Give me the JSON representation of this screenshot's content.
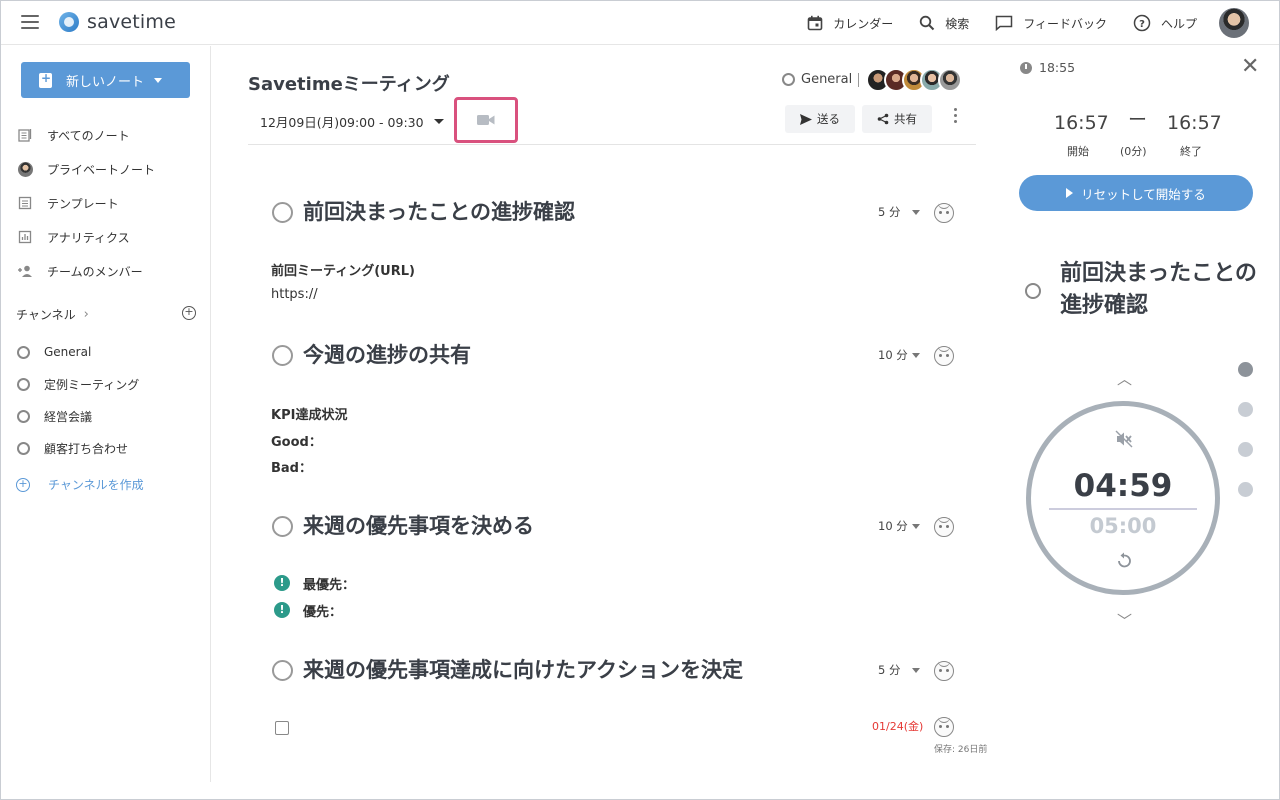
{
  "app": {
    "name": "savetime"
  },
  "topnav": [
    {
      "label": "カレンダー",
      "icon": "calendar-icon"
    },
    {
      "label": "検索",
      "icon": "search-icon"
    },
    {
      "label": "フィードバック",
      "icon": "feedback-icon"
    },
    {
      "label": "ヘルプ",
      "icon": "help-icon"
    }
  ],
  "sidebar": {
    "new_note": "新しいノート",
    "items": [
      {
        "label": "すべてのノート",
        "icon": "notes-icon"
      },
      {
        "label": "プライベートノート",
        "icon": "avatar-icon"
      },
      {
        "label": "テンプレート",
        "icon": "template-icon"
      },
      {
        "label": "アナリティクス",
        "icon": "analytics-icon"
      },
      {
        "label": "チームのメンバー",
        "icon": "add-member-icon"
      }
    ],
    "channels_label": "チャンネル",
    "channels": [
      "General",
      "定例ミーティング",
      "経営会議",
      "顧客打ち合わせ"
    ],
    "create_channel": "チャンネルを作成"
  },
  "note": {
    "title": "Savetimeミーティング",
    "channel": "General",
    "date": "12月09日(月)09:00 - 09:30",
    "send": "送る",
    "share": "共有",
    "agenda": [
      {
        "title": "前回決まったことの進捗確認",
        "minutes": "5 分"
      },
      {
        "title": "今週の進捗の共有",
        "minutes": "10 分"
      },
      {
        "title": "来週の優先事項を決める",
        "minutes": "10 分"
      },
      {
        "title": "来週の優先事項達成に向けたアクションを決定",
        "minutes": "5 分"
      }
    ],
    "body1": {
      "heading": "前回ミーティング(URL)",
      "text": "https://"
    },
    "body2": {
      "heading": "KPI達成状況",
      "good": "Good：",
      "bad": "Bad："
    },
    "body3": {
      "top": "最優先：",
      "second": "優先："
    },
    "due": "01/24(金)",
    "saved": "保存: 26日前"
  },
  "timer": {
    "clock": "18:55",
    "start_time": "16:57",
    "end_time": "16:57",
    "start_label": "開始",
    "end_label": "終了",
    "dash": "ー",
    "duration": "(0分)",
    "reset_label": "リセットして開始する",
    "topic": "前回決まったことの進捗確認",
    "remaining": "04:59",
    "total": "05:00",
    "agenda_count": 4,
    "active_index": 0
  },
  "colors": {
    "accent": "#5b99d7",
    "highlight": "#d9517e",
    "due": "#e53935",
    "warn": "#2c9a8a"
  }
}
